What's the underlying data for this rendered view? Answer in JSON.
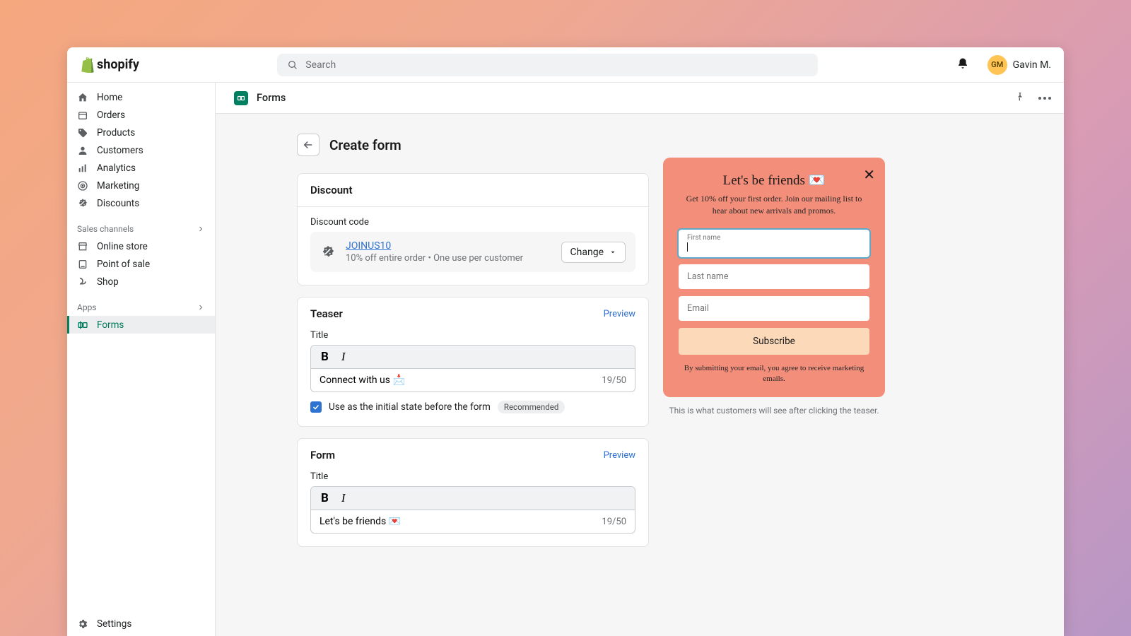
{
  "topbar": {
    "brand": "shopify",
    "search_placeholder": "Search",
    "user_initials": "GM",
    "user_name": "Gavin M."
  },
  "sidebar": {
    "primary": [
      {
        "label": "Home"
      },
      {
        "label": "Orders"
      },
      {
        "label": "Products"
      },
      {
        "label": "Customers"
      },
      {
        "label": "Analytics"
      },
      {
        "label": "Marketing"
      },
      {
        "label": "Discounts"
      }
    ],
    "channels_header": "Sales channels",
    "channels": [
      {
        "label": "Online store"
      },
      {
        "label": "Point of sale"
      },
      {
        "label": "Shop"
      }
    ],
    "apps_header": "Apps",
    "apps": [
      {
        "label": "Forms"
      }
    ],
    "settings_label": "Settings"
  },
  "page": {
    "app_title": "Forms",
    "title": "Create form"
  },
  "discount": {
    "card_title": "Discount",
    "label": "Discount code",
    "code": "JOINUS10",
    "description": "10% off entire order • One use per customer",
    "change_label": "Change"
  },
  "teaser": {
    "card_title": "Teaser",
    "preview_label": "Preview",
    "title_label": "Title",
    "value": "Connect with us 📩",
    "count": "19/50",
    "checkbox_label": "Use as the initial state before the form",
    "badge": "Recommended"
  },
  "form": {
    "card_title": "Form",
    "preview_label": "Preview",
    "title_label": "Title",
    "value": "Let's be friends 💌",
    "count": "19/50"
  },
  "preview": {
    "title": "Let's be friends 💌",
    "subtitle": "Get 10% off your first order. Join our mailing list to hear about new arrivals and promos.",
    "first_name_label": "First name",
    "last_name_placeholder": "Last name",
    "email_placeholder": "Email",
    "subscribe_label": "Subscribe",
    "legal": "By submitting your email, you agree to receive marketing emails.",
    "footnote": "This is what customers will see after clicking the teaser."
  }
}
